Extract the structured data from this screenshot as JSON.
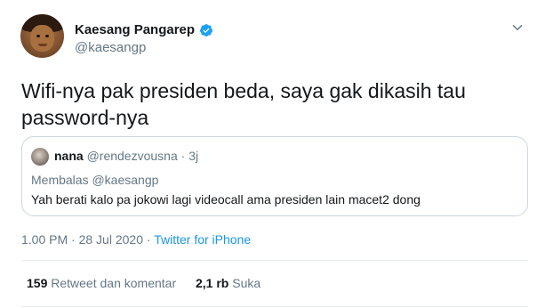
{
  "author": {
    "display_name": "Kaesang Pangarep",
    "handle": "@kaesangp",
    "verified_icon": "verified-badge-icon",
    "verified_color": "#1da1f2"
  },
  "tweet": {
    "text": "Wifi-nya pak presiden beda, saya gak dikasih tau password-nya"
  },
  "quoted": {
    "name": "nana",
    "handle": "@rendezvousna",
    "separator": "·",
    "time": "3j",
    "reply_to": "Membalas @kaesangp",
    "text": "Yah berati kalo pa jokowi lagi videocall ama presiden lain macet2 dong"
  },
  "meta": {
    "time": "1.00 PM",
    "sep1": " · ",
    "date": "28 Jul 2020",
    "sep2": " · ",
    "source": "Twitter for iPhone",
    "source_color": "#1b95e0"
  },
  "stats": {
    "retweets_count": "159",
    "retweets_label": "Retweet dan komentar",
    "likes_count": "2,1 rb",
    "likes_label": "Suka"
  },
  "colors": {
    "text": "#14171a",
    "secondary": "#657786",
    "border": "#ccd6dd",
    "divider": "#e6ecf0"
  }
}
